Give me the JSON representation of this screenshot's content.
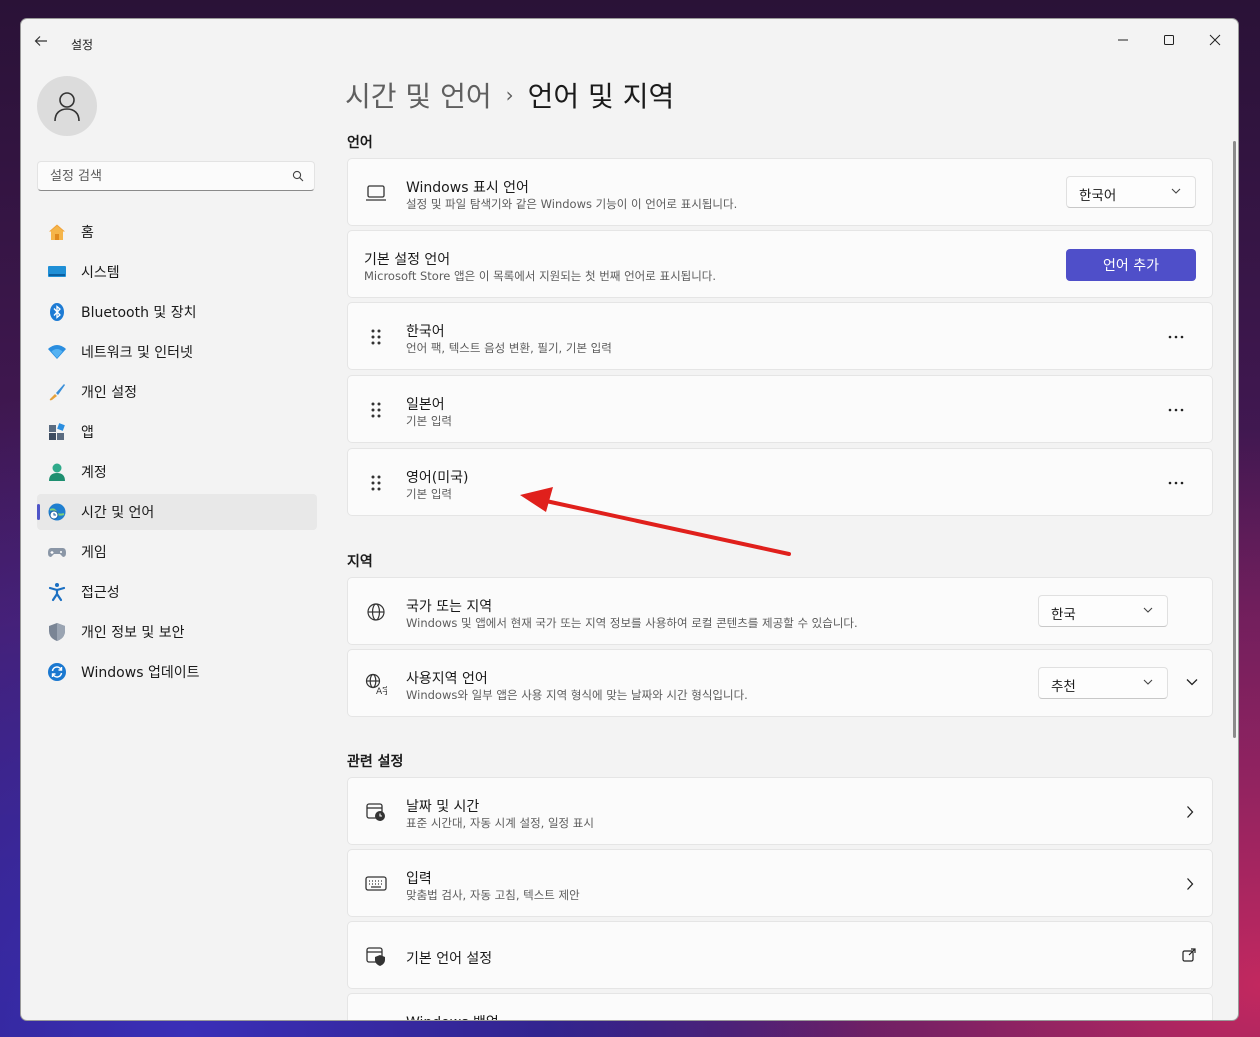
{
  "window": {
    "title": "설정",
    "controls": {
      "minimize": "minimize-icon",
      "maximize": "maximize-icon",
      "close": "close-icon"
    }
  },
  "sidebar": {
    "search_placeholder": "설정 검색",
    "items": [
      {
        "label": "홈",
        "icon": "home-icon",
        "active": false
      },
      {
        "label": "시스템",
        "icon": "system-icon",
        "active": false
      },
      {
        "label": "Bluetooth 및 장치",
        "icon": "bluetooth-icon",
        "active": false
      },
      {
        "label": "네트워크 및 인터넷",
        "icon": "wifi-icon",
        "active": false
      },
      {
        "label": "개인 설정",
        "icon": "brush-icon",
        "active": false
      },
      {
        "label": "앱",
        "icon": "apps-icon",
        "active": false
      },
      {
        "label": "계정",
        "icon": "account-icon",
        "active": false
      },
      {
        "label": "시간 및 언어",
        "icon": "time-language-icon",
        "active": true
      },
      {
        "label": "게임",
        "icon": "gamepad-icon",
        "active": false
      },
      {
        "label": "접근성",
        "icon": "accessibility-icon",
        "active": false
      },
      {
        "label": "개인 정보 및 보안",
        "icon": "shield-icon",
        "active": false
      },
      {
        "label": "Windows 업데이트",
        "icon": "update-icon",
        "active": false
      }
    ]
  },
  "header": {
    "parent": "시간 및 언어",
    "separator": "›",
    "current": "언어 및 지역"
  },
  "language_section": {
    "title": "언어",
    "display_language": {
      "title": "Windows 표시 언어",
      "desc": "설정 및 파일 탐색기와 같은 Windows 기능이 이 언어로 표시됩니다.",
      "value": "한국어"
    },
    "preferred": {
      "title": "기본 설정 언어",
      "desc": "Microsoft Store 앱은 이 목록에서 지원되는 첫 번째 언어로 표시됩니다.",
      "button": "언어 추가"
    },
    "languages": [
      {
        "title": "한국어",
        "desc": "언어 팩, 텍스트 음성 변환, 필기, 기본 입력"
      },
      {
        "title": "일본어",
        "desc": "기본 입력"
      },
      {
        "title": "영어(미국)",
        "desc": "기본 입력"
      }
    ]
  },
  "region_section": {
    "title": "지역",
    "country": {
      "title": "국가 또는 지역",
      "desc": "Windows 및 앱에서 현재 국가 또는 지역 정보를 사용하여 로컬 콘텐츠를 제공할 수 있습니다.",
      "value": "한국"
    },
    "regional_format": {
      "title": "사용지역 언어",
      "desc": "Windows와 일부 앱은 사용 지역 형식에 맞는 날짜와 시간 형식입니다.",
      "value": "추천"
    }
  },
  "related_section": {
    "title": "관련 설정",
    "items": [
      {
        "title": "날짜 및 시간",
        "desc": "표준 시간대, 자동 시계 설정, 일정 표시"
      },
      {
        "title": "입력",
        "desc": "맞춤법 검사, 자동 고침, 텍스트 제안"
      },
      {
        "title": "기본 언어 설정",
        "desc": ""
      },
      {
        "title": "Windows 백업",
        "desc": ""
      }
    ]
  },
  "colors": {
    "accent": "#4f4fc9",
    "annotation_arrow": "#e0201c"
  }
}
